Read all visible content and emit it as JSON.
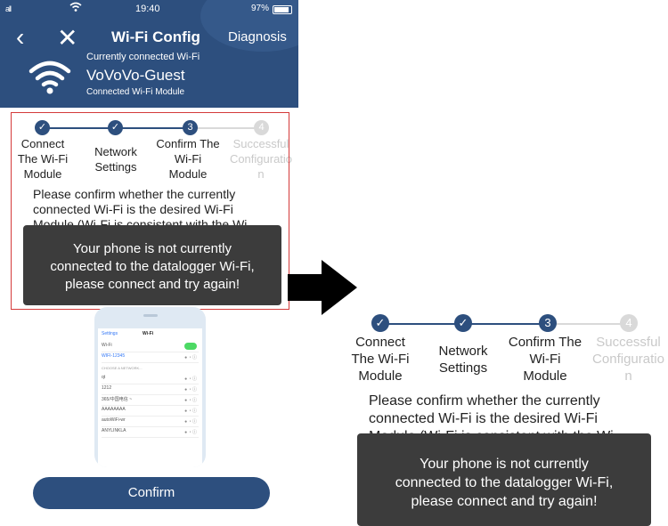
{
  "status_bar": {
    "signal": "all",
    "time": "19:40",
    "battery": "97%"
  },
  "header": {
    "title": "Wi-Fi Config",
    "diagnosis_label": "Diagnosis",
    "current_label": "Currently connected Wi-Fi",
    "ssid": "VoVoVo-Guest",
    "module_label": "Connected Wi-Fi Module"
  },
  "steps": [
    {
      "marker": "✓",
      "label": "Connect\nThe Wi-Fi\nModule",
      "state": "done"
    },
    {
      "marker": "✓",
      "label": "Network\nSettings",
      "state": "done"
    },
    {
      "marker": "3",
      "label": "Confirm The\nWi-Fi\nModule",
      "state": "current"
    },
    {
      "marker": "4",
      "label": "Successful\nConfiguratio\nn",
      "state": "todo"
    }
  ],
  "left_message": "Please confirm whether the currently connected Wi-Fi is the desired Wi-Fi Module (Wi-Fi is consistent with the Wi",
  "right_message": "Please confirm whether the currently connected Wi-Fi is the desired Wi-Fi Module (Wi-Fi is consistent with the Wi",
  "toast": "Your phone is not currently\nconnected to the datalogger Wi-Fi,\nplease connect and try again!",
  "mini_phone": {
    "back_label": "Settings",
    "title": "Wi-Fi",
    "wifi_label": "Wi-Fi",
    "connected_ssid": "WIFI-12345",
    "choose_label": "CHOOSE A NETWORK...",
    "networks": [
      "qt",
      "1212",
      "365/中国电信 ~",
      "AAAAAAAA",
      "autoWiFi-wr",
      "ANYLINKLA"
    ]
  },
  "confirm_label": "Confirm",
  "colors": {
    "header": "#2d4f7e",
    "step_done": "#2d4f7e",
    "step_todo": "#d9d9d9",
    "toast": "#3c3c3c",
    "highlight": "#d43a3a"
  }
}
